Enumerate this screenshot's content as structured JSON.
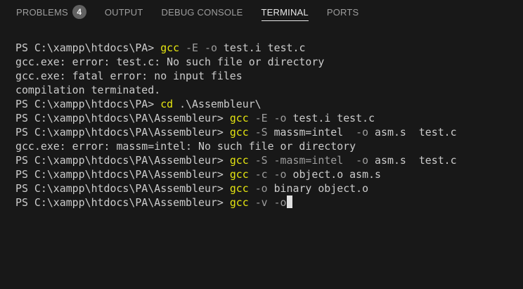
{
  "tabs": [
    {
      "label": "PROBLEMS",
      "badge": "4"
    },
    {
      "label": "OUTPUT"
    },
    {
      "label": "DEBUG CONSOLE"
    },
    {
      "label": "TERMINAL",
      "active": true
    },
    {
      "label": "PORTS"
    }
  ],
  "terminal": {
    "lines": [
      {
        "prompt": "PS C:\\xampp\\htdocs\\PA> ",
        "cmd": "gcc",
        "args": [
          " ",
          {
            "flag": "-E"
          },
          " ",
          {
            "flag": "-o"
          },
          " test.i test.c"
        ]
      },
      {
        "text": "gcc.exe: error: test.c: No such file or directory"
      },
      {
        "text": "gcc.exe: fatal error: no input files"
      },
      {
        "text": "compilation terminated."
      },
      {
        "prompt": "PS C:\\xampp\\htdocs\\PA> ",
        "cmd": "cd",
        "args": [
          " .\\Assembleur\\"
        ]
      },
      {
        "prompt": "PS C:\\xampp\\htdocs\\PA\\Assembleur> ",
        "cmd": "gcc",
        "args": [
          " ",
          {
            "flag": "-E"
          },
          " ",
          {
            "flag": "-o"
          },
          " test.i test.c"
        ]
      },
      {
        "prompt": "PS C:\\xampp\\htdocs\\PA\\Assembleur> ",
        "cmd": "gcc",
        "args": [
          " ",
          {
            "flag": "-S"
          },
          " massm=intel  ",
          {
            "flag": "-o"
          },
          " asm.s  test.c"
        ]
      },
      {
        "text": "gcc.exe: error: massm=intel: No such file or directory"
      },
      {
        "prompt": "PS C:\\xampp\\htdocs\\PA\\Assembleur> ",
        "cmd": "gcc",
        "args": [
          " ",
          {
            "flag": "-S"
          },
          " ",
          {
            "flag": "-masm=intel"
          },
          "  ",
          {
            "flag": "-o"
          },
          " asm.s  test.c"
        ]
      },
      {
        "prompt": "PS C:\\xampp\\htdocs\\PA\\Assembleur> ",
        "cmd": "gcc",
        "args": [
          " ",
          {
            "flag": "-c"
          },
          " ",
          {
            "flag": "-o"
          },
          " object.o asm.s"
        ]
      },
      {
        "prompt": "PS C:\\xampp\\htdocs\\PA\\Assembleur> ",
        "cmd": "gcc",
        "args": [
          " ",
          {
            "flag": "-o"
          },
          " binary object.o"
        ]
      },
      {
        "prompt": "PS C:\\xampp\\htdocs\\PA\\Assembleur> ",
        "cmd": "gcc",
        "args": [
          " ",
          {
            "flag": "-v"
          },
          " ",
          {
            "flag": "-o"
          }
        ],
        "cursor": true
      }
    ]
  },
  "colors": {
    "background": "#181818",
    "text": "#cccccc",
    "command": "#e5e510",
    "flag": "#9d9d9d",
    "tab_active": "#e7e7e7",
    "tab_inactive": "#9d9d9d"
  }
}
